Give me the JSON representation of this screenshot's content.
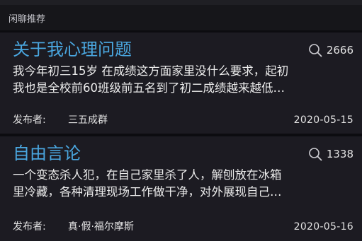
{
  "section": {
    "title": "闲聊推荐"
  },
  "posts": [
    {
      "title": "关于我心理问题",
      "views": "2666",
      "excerpt_line1": "我今年初三15岁 在成绩这方面家里没什么要求，起初",
      "excerpt_line2": "我也是全校前60班级前五名到了初二成绩越来越低…",
      "publisher_label": "发布者:",
      "author": "三五成群",
      "date": "2020-05-15",
      "views_icon": "search-icon"
    },
    {
      "title": "自由言论",
      "views": "1338",
      "excerpt_line1": "一个变态杀人犯，在自己家里杀了人，解刨放在冰箱",
      "excerpt_line2": "里冷藏，各种清理现场工作做干净，对外展现自己…",
      "publisher_label": "发布者:",
      "author": "真·假·福尔摩斯",
      "date": "2020-05-16",
      "views_icon": "search-icon"
    }
  ],
  "colors": {
    "title_accent": "#4aa7e0",
    "background": "#0c0c10",
    "card": "#1c1b22"
  }
}
